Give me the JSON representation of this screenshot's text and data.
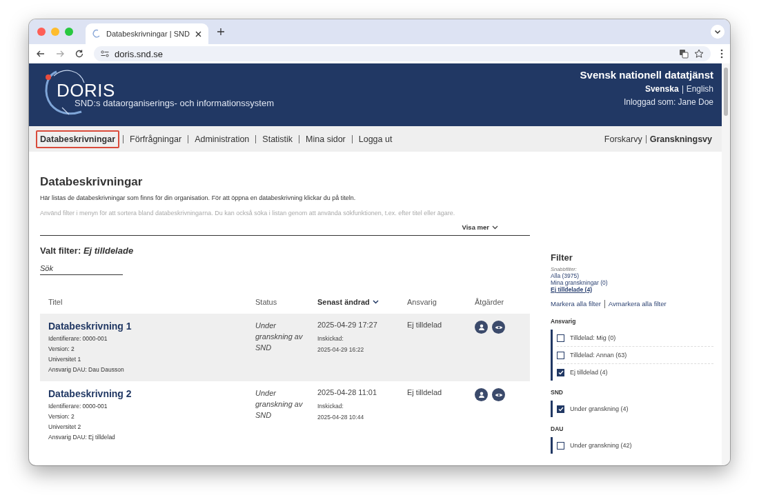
{
  "browser": {
    "tab_title": "Databeskrivningar | SND",
    "address": "doris.snd.se"
  },
  "header": {
    "logo": "DORIS",
    "subtitle": "SND:s dataorganiserings- och informationssystem",
    "org": "Svensk nationell datatjänst",
    "languages": [
      {
        "label": "Svenska",
        "selected": true
      },
      {
        "label": "English",
        "selected": false
      }
    ],
    "user": "Inloggad som: Jane Doe"
  },
  "nav": {
    "items": [
      {
        "label": "Databeskrivningar",
        "selected": true
      },
      {
        "label": "Förfrågningar",
        "selected": false
      },
      {
        "label": "Administration",
        "selected": false
      },
      {
        "label": "Statistik",
        "selected": false
      },
      {
        "label": "Mina sidor",
        "selected": false
      },
      {
        "label": "Logga ut",
        "selected": false
      }
    ],
    "views": [
      {
        "label": "Forskarvy",
        "selected": false
      },
      {
        "label": "Granskningsvy",
        "selected": true
      }
    ]
  },
  "page": {
    "title": "Databeskrivningar",
    "intro": "Här listas de databeskrivningar som finns för din organisation. För att öppna en databeskrivning klickar du på titeln.",
    "intro_faded": "Använd filter i menyn för att sortera bland databeskrivningarna. Du kan också söka i listan genom att använda sökfunktionen, t.ex. efter titel eller ägare.",
    "show_more": "Visa mer"
  },
  "selected_filter": {
    "label": "Valt filter:",
    "value": "Ej tilldelade"
  },
  "search": {
    "placeholder": "Sök"
  },
  "table": {
    "columns": [
      {
        "label": "Titel",
        "sorted": false
      },
      {
        "label": "Status",
        "sorted": false
      },
      {
        "label": "Senast ändrad",
        "sorted": true
      },
      {
        "label": "Ansvarig",
        "sorted": false
      },
      {
        "label": "Åtgärder",
        "sorted": false
      }
    ],
    "rows": [
      {
        "highlighted": true,
        "title": "Databeskrivning 1",
        "details": [
          "Identifierare: 0000-001",
          "Version: 2",
          "Universitet 1",
          "Ansvarig DAU: Dau Dausson"
        ],
        "status": "Under granskning av SND",
        "modified": "2025-04-29 17:27",
        "submitted_label": "Inskickad:",
        "submitted": "2025-04-29 16:22",
        "responsible": "Ej tilldelad"
      },
      {
        "highlighted": false,
        "title": "Databeskrivning 2",
        "details": [
          "Identifierare: 0000-001",
          "Version: 2",
          "Universitet 2",
          "Ansvarig DAU: Ej tilldelad"
        ],
        "status": "Under granskning av SND",
        "modified": "2025-04-28 11:01",
        "submitted_label": "Inskickad:",
        "submitted": "2025-04-28 10:44",
        "responsible": "Ej tilldelad"
      }
    ]
  },
  "filter": {
    "title": "Filter",
    "quick_label": "Snabbfilter:",
    "quick": [
      {
        "label": "Alla (3975)",
        "selected": false
      },
      {
        "label": "Mina granskningar (0)",
        "selected": false
      },
      {
        "label": "Ej tilldelade (4)",
        "selected": true
      }
    ],
    "select_all": "Markera alla filter",
    "deselect_all": "Avmarkera alla filter",
    "groups": [
      {
        "title": "Ansvarig",
        "options": [
          {
            "label": "Tilldelad: Mig (0)",
            "checked": false
          },
          {
            "label": "Tilldelad: Annan (63)",
            "checked": false
          },
          {
            "label": "Ej tilldelad (4)",
            "checked": true
          }
        ]
      },
      {
        "title": "SND",
        "options": [
          {
            "label": "Under granskning (4)",
            "checked": true
          }
        ]
      },
      {
        "title": "DAU",
        "options": [
          {
            "label": "Under granskning (42)",
            "checked": false
          }
        ]
      }
    ]
  }
}
